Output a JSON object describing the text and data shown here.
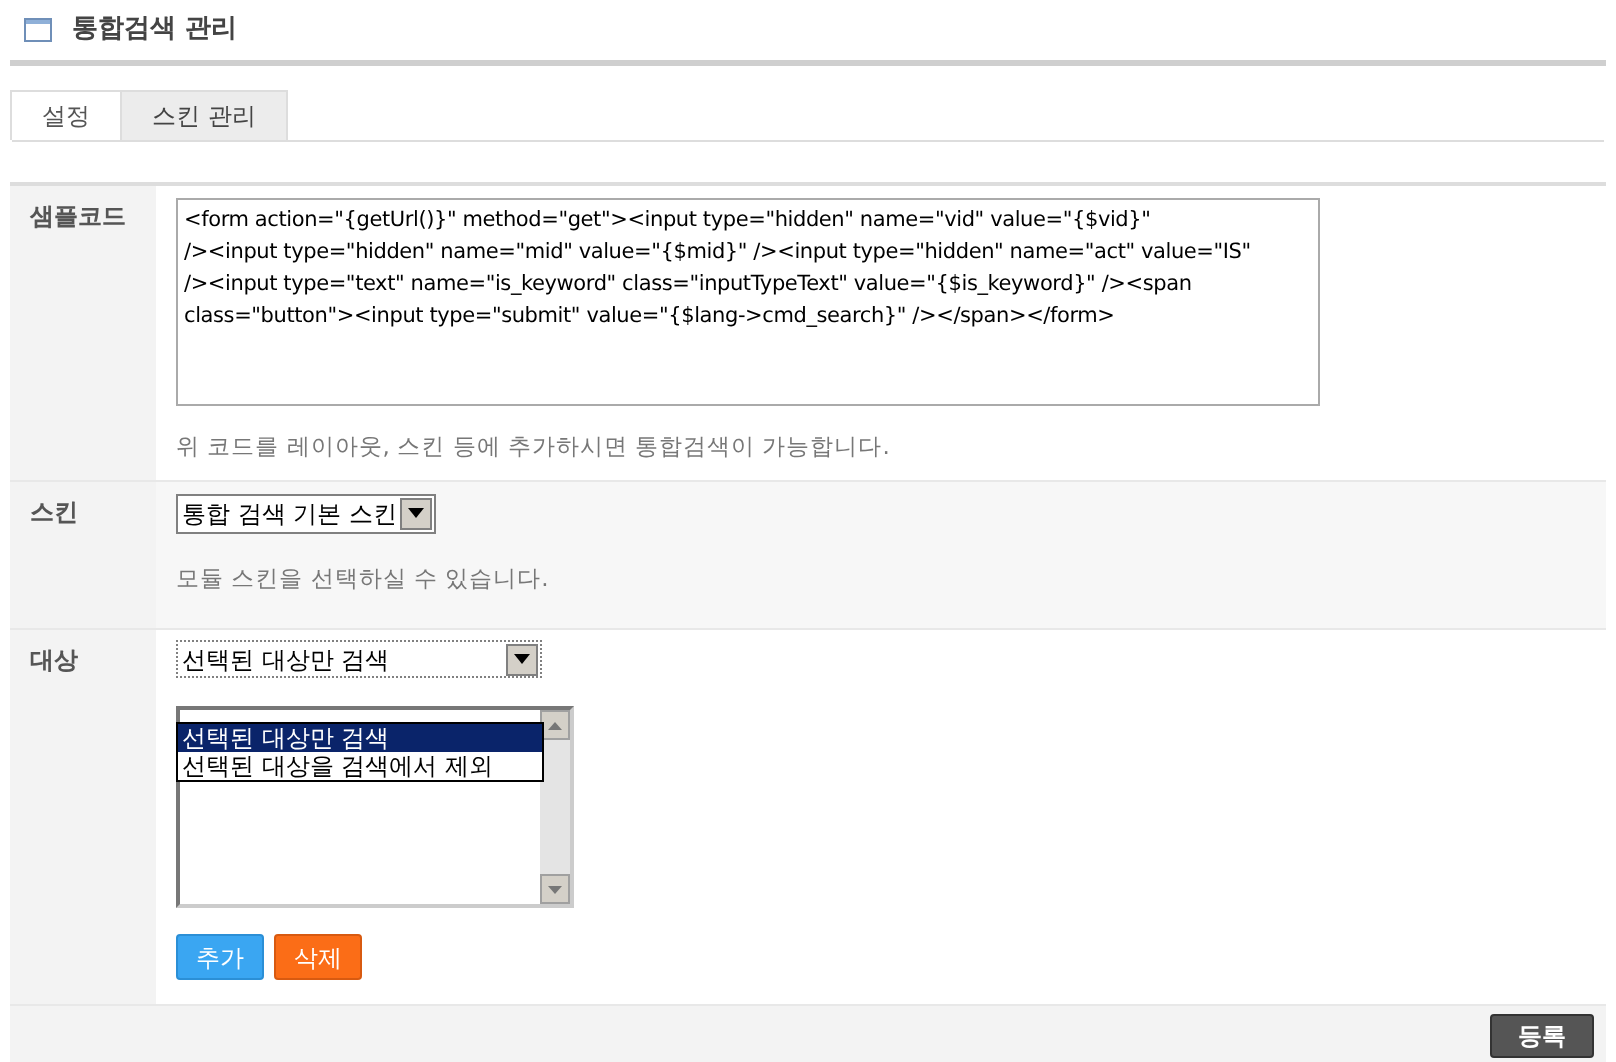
{
  "page_title": "통합검색 관리",
  "tabs": [
    {
      "label": "설정",
      "selected": true
    },
    {
      "label": "스킨 관리",
      "selected": false
    }
  ],
  "sample_code": {
    "label": "샘플코드",
    "lines": [
      "<form action=\"{getUrl()}\" method=\"get\"><input type=\"hidden\" name=\"vid\" value=\"{$vid}\"",
      "/><input type=\"hidden\" name=\"mid\" value=\"{$mid}\" /><input type=\"hidden\" name=\"act\" value=\"IS\"",
      "/><input type=\"text\" name=\"is_keyword\" class=\"inputTypeText\" value=\"{$is_keyword}\" /><span",
      "class=\"button\"><input type=\"submit\" value=\"{$lang->cmd_search}\" /></span></form>"
    ],
    "help": "위 코드를 레이아웃, 스킨 등에 추가하시면 통합검색이 가능합니다."
  },
  "skin": {
    "label": "스킨",
    "value": "통합 검색 기본 스킨",
    "help": "모듈 스킨을 선택하실 수 있습니다."
  },
  "target": {
    "label": "대상",
    "value": "선택된 대상만 검색",
    "expanded": true,
    "options": [
      {
        "label": "선택된 대상만 검색",
        "selected": true
      },
      {
        "label": "선택된 대상을 검색에서 제외",
        "selected": false
      }
    ],
    "buttons": [
      {
        "label": "추가",
        "kind": "add"
      },
      {
        "label": "삭제",
        "kind": "delete"
      }
    ]
  },
  "submit": "등록"
}
